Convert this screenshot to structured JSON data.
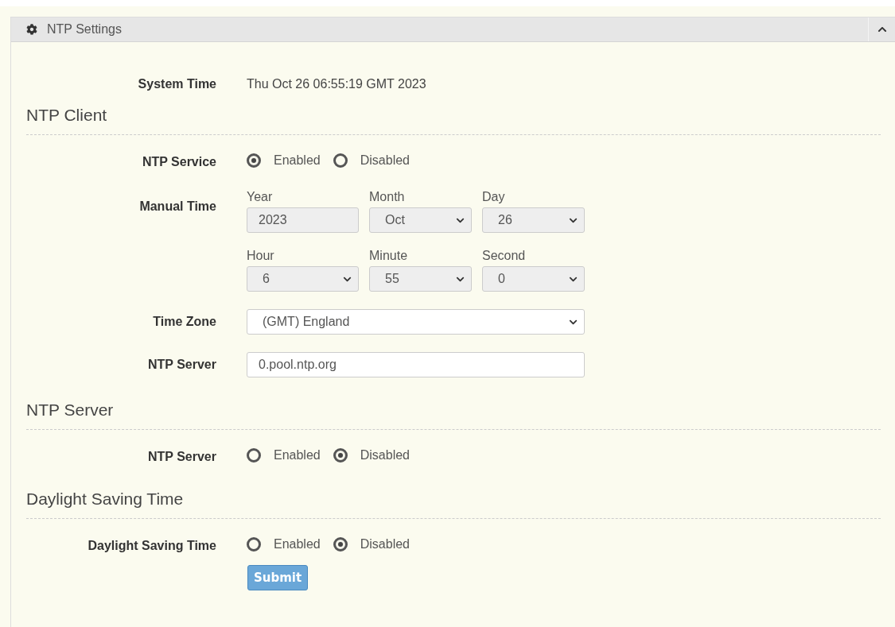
{
  "panel": {
    "title": "NTP Settings"
  },
  "system_time": {
    "label": "System Time",
    "value": "Thu Oct 26 06:55:19 GMT 2023"
  },
  "sections": [
    {
      "heading": "NTP Client",
      "rows": [
        {
          "kind": "radio",
          "label": "NTP Service",
          "options": [
            {
              "label": "Enabled",
              "selected": true
            },
            {
              "label": "Disabled",
              "selected": false
            }
          ]
        },
        {
          "kind": "manual_time",
          "label": "Manual Time",
          "disabled": true,
          "fields": [
            {
              "kind": "text",
              "label": "Year",
              "value": "2023"
            },
            {
              "kind": "select",
              "label": "Month",
              "value": "Oct"
            },
            {
              "kind": "select",
              "label": "Day",
              "value": "26"
            },
            {
              "kind": "select",
              "label": "Hour",
              "value": "6"
            },
            {
              "kind": "select",
              "label": "Minute",
              "value": "55"
            },
            {
              "kind": "select",
              "label": "Second",
              "value": "0"
            }
          ]
        },
        {
          "kind": "select",
          "label": "Time Zone",
          "value": "(GMT) England"
        },
        {
          "kind": "input",
          "label": "NTP Server",
          "value": "0.pool.ntp.org"
        }
      ]
    },
    {
      "heading": "NTP Server",
      "rows": [
        {
          "kind": "radio",
          "label": "NTP Server",
          "options": [
            {
              "label": "Enabled",
              "selected": false
            },
            {
              "label": "Disabled",
              "selected": true
            }
          ]
        }
      ]
    },
    {
      "heading": "Daylight Saving Time",
      "rows": [
        {
          "kind": "radio",
          "label": "Daylight Saving Time",
          "options": [
            {
              "label": "Enabled",
              "selected": false
            },
            {
              "label": "Disabled",
              "selected": true
            }
          ]
        }
      ]
    }
  ],
  "submit": {
    "label": "Submit"
  }
}
